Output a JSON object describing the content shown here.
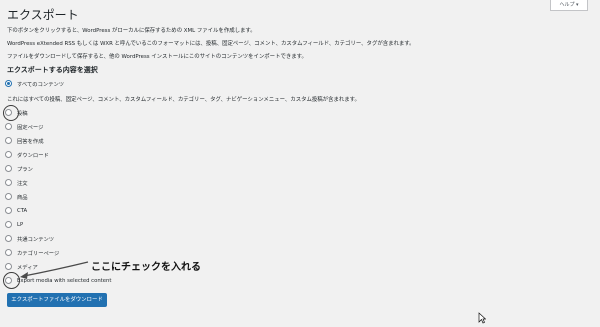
{
  "help_tab": "ヘルプ ▾",
  "title": "エクスポート",
  "descriptions": [
    "下のボタンをクリックすると、WordPress がローカルに保存するための XML ファイルを作成します。",
    "WordPress eXtended RSS もしくは WXR と呼んでいるこのフォーマットには、投稿、固定ページ、コメント、カスタムフィールド、カテゴリー、タグが含まれます。",
    "ファイルをダウンロードして保存すると、他の WordPress インストールにこのサイトのコンテンツをインポートできます。"
  ],
  "section_title": "エクスポートする内容を選択",
  "all_content": {
    "label": "すべてのコンテンツ",
    "description": "これにはすべての投稿、固定ページ、コメント、カスタムフィールド、カテゴリー、タグ、ナビゲーションメニュー、カスタム投稿が含まれます。"
  },
  "options": [
    "投稿",
    "固定ページ",
    "回答を作成",
    "ダウンロード",
    "プラン",
    "注文",
    "商品",
    "CTA",
    "LP",
    "共通コンテンツ",
    "カテゴリーページ",
    "メディア"
  ],
  "export_media_label": "Export media with selected content",
  "annotation": "ここにチェックを入れる",
  "download_button": "エクスポートファイルをダウンロード",
  "colors": {
    "accent": "#2271b1",
    "background": "#f1f1f1"
  }
}
